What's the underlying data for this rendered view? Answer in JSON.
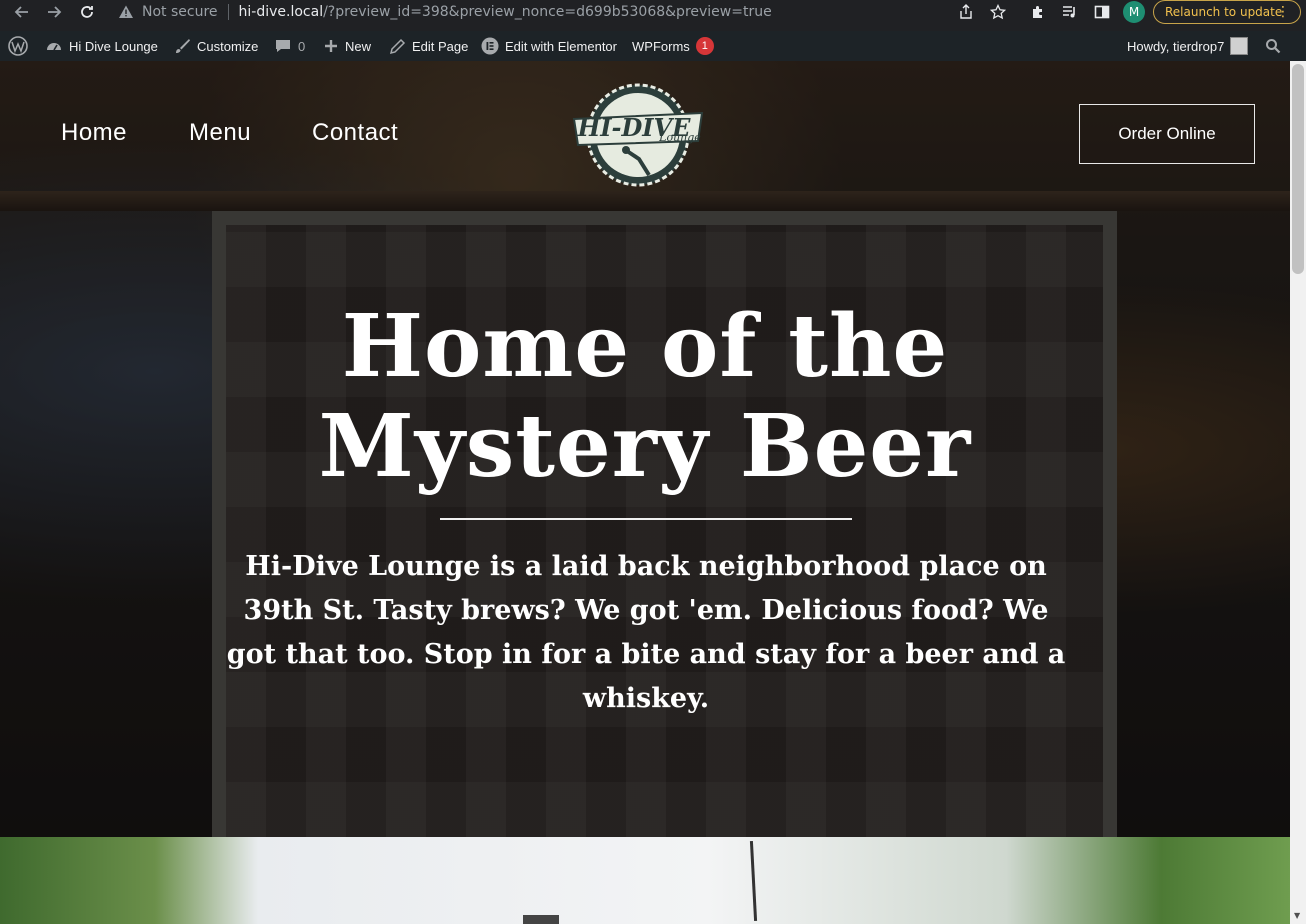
{
  "browser": {
    "security_label": "Not secure",
    "url_host": "hi-dive.local",
    "url_path": "/?preview_id=398&preview_nonce=d699b53068&preview=true",
    "profile_initial": "M",
    "relaunch_label": "Relaunch to update",
    "accent_color": "#f2c14e"
  },
  "admin_bar": {
    "site_name": "Hi Dive Lounge",
    "customize": "Customize",
    "comments_count": "0",
    "new": "New",
    "edit_page": "Edit Page",
    "edit_elementor": "Edit with Elementor",
    "wpforms": "WPForms",
    "wpforms_badge": "1",
    "howdy": "Howdy, tierdrop7"
  },
  "site_nav": {
    "items": [
      "Home",
      "Menu",
      "Contact"
    ],
    "order_button": "Order Online",
    "logo_text": "HI-DIVE",
    "logo_subtext": "Lounge"
  },
  "hero": {
    "title_line1": "Home of the",
    "title_line2": "Mystery Beer",
    "description": "Hi-Dive Lounge is a laid back neighborhood place on 39th St. Tasty brews? We got 'em. Delicious food? We got that too. Stop in for a bite and stay for a beer and a whiskey."
  }
}
